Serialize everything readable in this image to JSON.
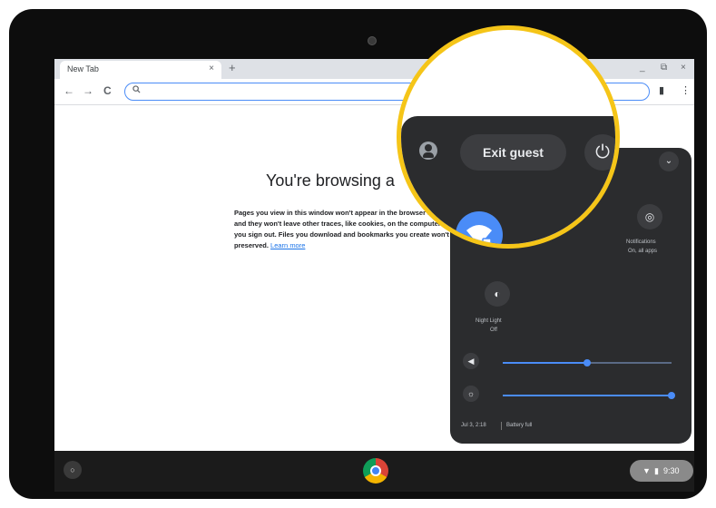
{
  "browser": {
    "tab_title": "New Tab",
    "tab_close": "×",
    "new_tab": "+",
    "window_controls": [
      "_",
      "⧉",
      "×"
    ],
    "nav": {
      "back": "←",
      "forward": "→",
      "reload": "C"
    },
    "omnibox": {
      "icon": "search-icon",
      "value": ""
    },
    "toolbar_right": [
      "▮",
      "⋮"
    ]
  },
  "page": {
    "title": "You're browsing a",
    "body": "Pages you view in this window won't appear in the browser history and they won't leave other traces, like cookies, on the computer after you sign out. Files you download and bookmarks you create won't be preserved.",
    "link": "Learn more"
  },
  "quick_settings": {
    "exit_guest": "Exit guest",
    "power_icon": "⏻",
    "collapse_icon": "⌄",
    "tile_right_label": "Notifications",
    "tile_right_sub": "On, all apps",
    "night_light_label": "Night Light",
    "night_light_sub": "Off",
    "footer_left": "Jul 3, 2:18",
    "footer_right": "Battery full",
    "volume_level": 0.5,
    "brightness_level": 1.0
  },
  "shelf": {
    "launcher": "○",
    "status_time": "9:30",
    "status_wifi": "▼",
    "status_battery": "▮"
  },
  "colors": {
    "accent": "#4a8cf7",
    "magnifier_ring": "#f5c518",
    "panel_bg": "#2b2c2e"
  }
}
